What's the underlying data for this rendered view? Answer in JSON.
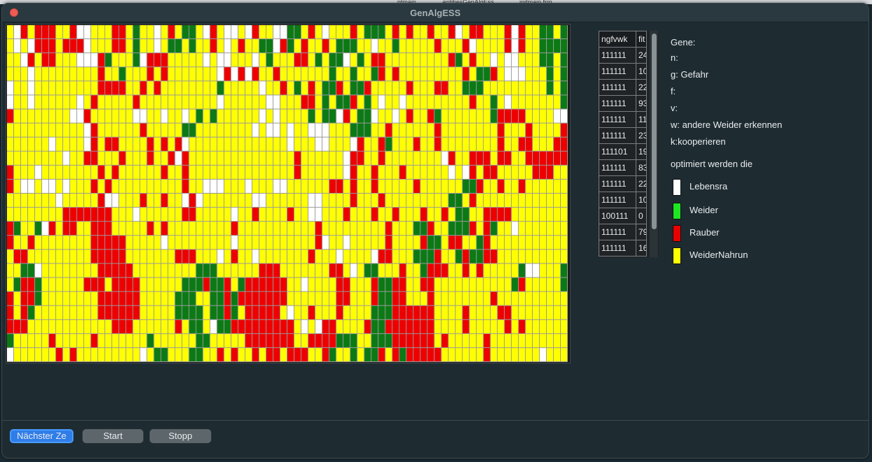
{
  "backdrop": {
    "tabs": [
      "ntmain",
      "entitiesGenAlgEss",
      "initmain.frm"
    ]
  },
  "window": {
    "title": "GenAlgESS"
  },
  "colors": {
    "white": "#ffffff",
    "green": "#0b7a14",
    "red": "#ee0000",
    "yellow": "#ffff00",
    "legend_green": "#1ee621",
    "legend_red": "#e80000",
    "legend_yellow": "#ffff00",
    "accent": "#2f7de8"
  },
  "grid": {
    "rows": 24,
    "cols": 80,
    "cells": [
      "YWRYRRRYYRWWYYYRRYGYYWYRYGGYWRYWWYWRYYWWGGYRYWYYYRYGGGYRYRYYRYYRWYRRYYYRWRYYGGYG",
      "YWYWRRRYRRRWYYYRRYGYYWYGGYGYYRYWYRYYGGWRGYRYYRYGGGYYWYYGYYYYYRYYYRWYYYYRWRYYGGGG",
      "YYWRYRRYYYWWWRGYYYGWRRRYYYYYWYWWYYYWYGYYYRRYGYGGWYGYRRYYYYYYYYYRGYRYYWYWWYYYGGYG",
      "YYYWYYYYYYYYYRYYGYYYRYRYYYYYYYWRWRWRYYRYYYYYYYGYYGYYGRYRYYYYYYYYYRYGGRYWWWYYYGYG",
      "WYYWYYYYYYYYYRRRRYYRYRYYYYYYYYGYYYYYWYYRYGYRYGGRYGGRYYYYYRYYYRRYYGGGYYYYYYYYYGYG",
      "WYYWYYYYYYWYRYYYYYRYYYYYYYYYYYWYYYYYYWWYYYRRYGYGGRYGYWYYWYYYYYYYYYRYYGYWYYYYYYYG",
      "RYYYYYYYYWWRYYYYYYWWYYWYYWYGYGYYYYYYWYWYYYYGYGGWRYGGWYYWYRYYRGYYYYYYYGRRRRYYYYWW",
      "YYYYYYYYYYYWRYYYYYYRYYYYYGGYYYYYYYYWYWWYWYYWWWYYYGGGYYRYYYYYYRYYYYYYYYRYYYRYYYYR",
      "YYYYYYWYYYYWRYRRYYYYRYRYRWYYYYYYYYYYYYYYWYYYWWYYYWRYYRGYYYRYYRYYYYYYYYRYYRRYYYRR",
      "YYYYYYYYWYYRRYYYRYYYRYYRWRYYYYYYYYYYYYYYYRYYYYYYWRRYYRYYYYYYYYWRYYRRRYRRYYRRRRRR",
      "RYYYWYYYYYYYYRYRYYYYYYRYYRYYYYYYYYYYYYYYYRYYYYYYWRYYRYYYRYYYYYYWYWRYRRYYYYYRRRYYY",
      "RYWWYWWYWYYYRYRYYYYYYYYYYRYYWWWYYYWYYYWWYYYYYYRRYRYYRYYYYYRYYYYYYGGRYYRYYRYYYYYY",
      "YYYYYYYWYYYYYRWWYYYRYYRYYWRWYYYYYYYWWYYYYYYWWYYYYRYYYRYYYYYYYYYGGYRYYYYYYYYYYYYY",
      "YYYYYYYYRRRRRRRYYYWYYYYYYRRYYYYYWYYRYYYYRYYWWYYYRYYYRYYRYYYRYYRYGGYYRRRRYYYYYYYY",
      "RGYYGWRYRRYYRRRYYYYYRYRYYYYYYYYYRYYYYYYYYYYYRYYYYYYYYYRYYYGGRYYGGGRYRGYYWYYYYYYY",
      "RYYRYYYYYYYYRRRRRYYYYYWYYYYYYYYYWYYYYYYYYYYYRWYYWYYYYYRYYYYRGGYRRYYGRYYYYYYYYYYY",
      "YRRYYYYYYYYYRRRRRYYYYYYYRRRYYYWYRYYWYYYYYYYRYYYWYYYYWRRYYYGGGRYYGRGGRRYYYYYYYYYY",
      "YYGGWYYYYYYYYRRRRRYYYYYYYYYGGGYYYYYYRRRYYYYYYYRRYWYGGYYYRYYGRRRYYRYRYYYYYGWWYYYGG",
      "YGRRGYYYYYYRRRYRRRRYYYYYYGGGRGGRYGRRRRRRYYWYYYYRRYYYRGGRRYYRRYYYYYYYYYYYGRYYYYYG",
      "RYRRGYYYYYYYYRRRRRRYYYYYGGGYYGGRGRRRRRRRYYYYYYYRRYYYRGGRRYYYRYYYYYYYYRYYYYYYYYYY",
      "RYRGYYYYYYYYYRRRRRRYYYYYGGGGYGGRGYRRRRRYWYYRYYYRYYYYGGGRRRRRRYYYYRYYYYRRYYYYYYYY",
      "RRRYYYYYYYYYYYYRRRYYYYYYRYGGYWGGRRRRRRRRRYWYWRRYYYYRGGRRRRRRRYYYYRYYYYYRYRYYYYYY",
      "GYYYYYRYYYYYRYYYYYYYGYYYYYYGGYYYYYRRRRRRRYYRRRRGGGYYGGGRRRRRRYRYYYYYRYYYYYYYYYYY",
      "WYYYYYYRYRYYYYYYYYYWYGGYYYGGYYRYRYYRYRRYRRRYYRGYYGYGGRYRGRRRRRYYYYYYRYYYYYYYWYYY"
    ]
  },
  "table": {
    "headers": [
      "ngfvwk",
      "fit"
    ],
    "rows": [
      [
        "111111",
        "24"
      ],
      [
        "111111",
        "10"
      ],
      [
        "111111",
        "22"
      ],
      [
        "111111",
        "93"
      ],
      [
        "111111",
        "11"
      ],
      [
        "111111",
        "23"
      ],
      [
        "111101",
        "19"
      ],
      [
        "111111",
        "83"
      ],
      [
        "111111",
        "22"
      ],
      [
        "111111",
        "10"
      ],
      [
        "100111",
        "0"
      ],
      [
        "111111",
        "79"
      ],
      [
        "111111",
        "16"
      ]
    ]
  },
  "info": {
    "genes_title": "Gene:",
    "n": "n:",
    "g": "g: Gefahr",
    "f": " f:",
    "v": "v:",
    "w": "w: andere Weider erkennen",
    "k": "k:kooperieren",
    "optimized": "optimiert werden die"
  },
  "legend": [
    {
      "label": "Lebensra",
      "color_key": "white"
    },
    {
      "label": "Weider",
      "color_key": "legend_green"
    },
    {
      "label": "Rauber",
      "color_key": "legend_red"
    },
    {
      "label": "WeiderNahrun",
      "color_key": "legend_yellow"
    }
  ],
  "buttons": {
    "next": "Nächster Ze",
    "start": "Start",
    "stop": "Stopp"
  }
}
